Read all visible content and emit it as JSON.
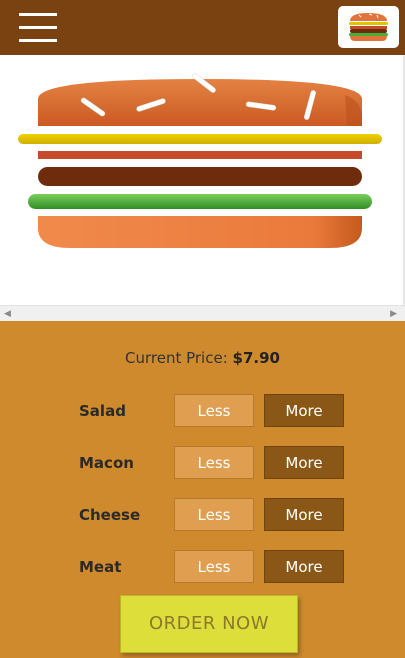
{
  "header": {
    "menu_icon": "hamburger-menu-icon",
    "logo_icon": "burger-logo-icon"
  },
  "burger": {
    "colors": {
      "bun": "#e0743a",
      "cheese": "#e2c300",
      "bacon": "#c44a2a",
      "meat": "#6e2c0c",
      "salad": "#49ad3a"
    }
  },
  "price": {
    "label": "Current Price:",
    "value": "$7.90"
  },
  "ingredients": [
    {
      "label": "Salad",
      "less": "Less",
      "more": "More"
    },
    {
      "label": "Macon",
      "less": "Less",
      "more": "More"
    },
    {
      "label": "Cheese",
      "less": "Less",
      "more": "More"
    },
    {
      "label": "Meat",
      "less": "Less",
      "more": "More"
    }
  ],
  "order_button": "ORDER NOW"
}
